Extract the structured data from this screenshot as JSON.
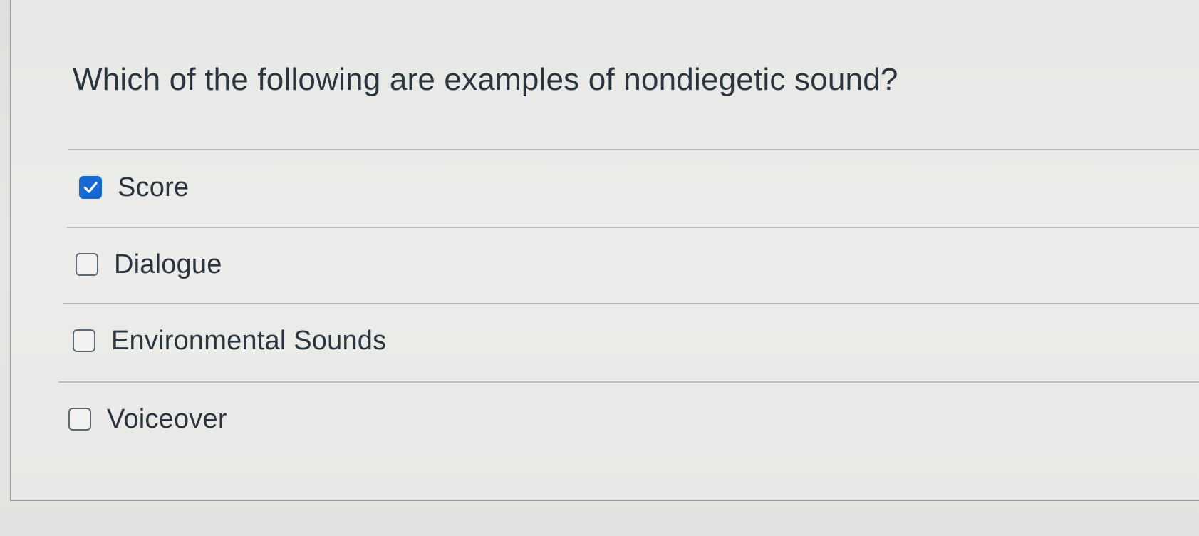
{
  "question": {
    "text": "Which of the following are examples of nondiegetic sound?"
  },
  "answers": [
    {
      "label": "Score",
      "checked": true
    },
    {
      "label": "Dialogue",
      "checked": false
    },
    {
      "label": "Environmental Sounds",
      "checked": false
    },
    {
      "label": "Voiceover",
      "checked": false
    }
  ],
  "colors": {
    "checkbox_checked": "#1769d4",
    "text": "#2a3540",
    "divider": "#b9bbb8"
  },
  "icons": {
    "checked": "checkmark-icon"
  }
}
